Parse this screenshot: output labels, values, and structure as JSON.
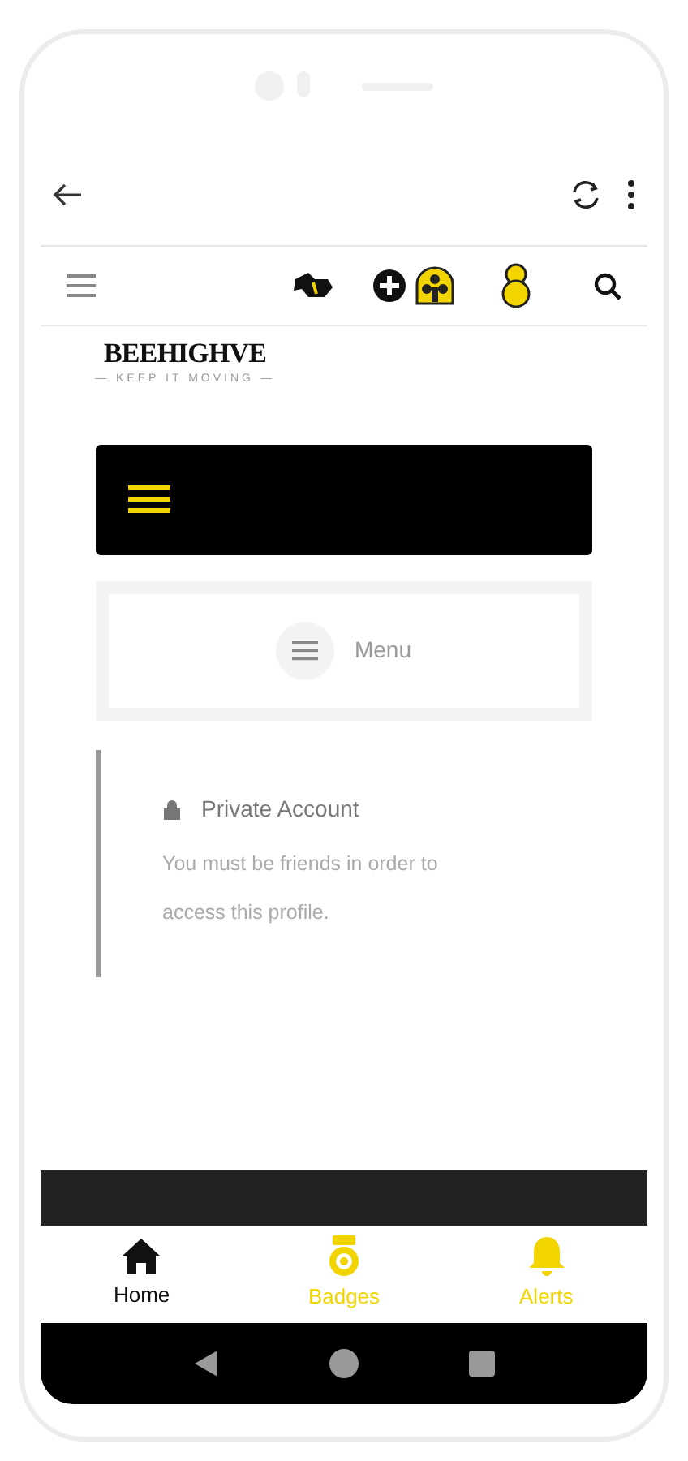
{
  "logo": {
    "name": "BEEHIGHVE",
    "tagline": "— KEEP IT MOVING —"
  },
  "menu": {
    "label": "Menu"
  },
  "notice": {
    "title": "Private Account",
    "message": "You must be friends in order to access this profile."
  },
  "bottom_nav": [
    {
      "label": "Home",
      "kind": "home",
      "selected": true
    },
    {
      "label": "Badges",
      "kind": "badge",
      "selected": false
    },
    {
      "label": "Alerts",
      "kind": "bell",
      "selected": false
    }
  ]
}
